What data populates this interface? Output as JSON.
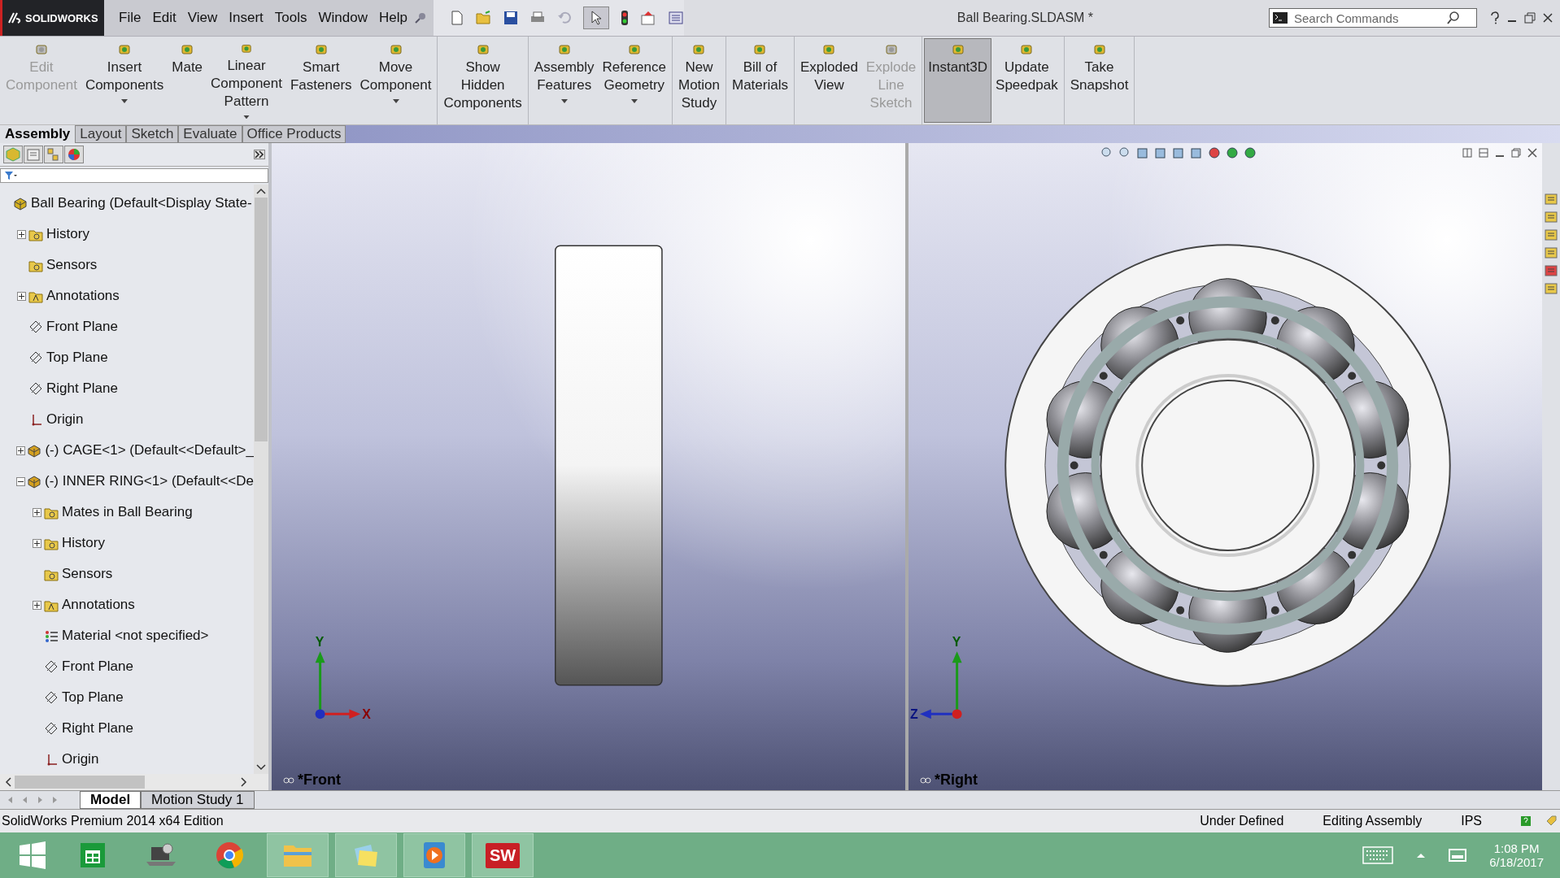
{
  "app": {
    "logo": "SOLIDWORKS",
    "menu": [
      "File",
      "Edit",
      "View",
      "Insert",
      "Tools",
      "Window",
      "Help"
    ],
    "title": "Ball Bearing.SLDASM *",
    "search": {
      "placeholder": "Search Commands"
    }
  },
  "ribbon": {
    "groups": [
      {
        "buttons": [
          {
            "label": "Edit\nComponent",
            "disabled": true,
            "selected": false,
            "dropdown": false
          },
          {
            "label": "Insert\nComponents",
            "disabled": false,
            "selected": false,
            "dropdown": true
          },
          {
            "label": "Mate",
            "disabled": false,
            "selected": false,
            "dropdown": false
          },
          {
            "label": "Linear\nComponent\nPattern",
            "disabled": false,
            "selected": false,
            "dropdown": true
          },
          {
            "label": "Smart\nFasteners",
            "disabled": false,
            "selected": false,
            "dropdown": false
          },
          {
            "label": "Move\nComponent",
            "disabled": false,
            "selected": false,
            "dropdown": true
          }
        ]
      },
      {
        "buttons": [
          {
            "label": "Show\nHidden\nComponents",
            "disabled": false,
            "selected": false,
            "dropdown": false
          }
        ]
      },
      {
        "buttons": [
          {
            "label": "Assembly\nFeatures",
            "disabled": false,
            "selected": false,
            "dropdown": true
          },
          {
            "label": "Reference\nGeometry",
            "disabled": false,
            "selected": false,
            "dropdown": true
          }
        ]
      },
      {
        "buttons": [
          {
            "label": "New\nMotion\nStudy",
            "disabled": false,
            "selected": false,
            "dropdown": false
          }
        ]
      },
      {
        "buttons": [
          {
            "label": "Bill of\nMaterials",
            "disabled": false,
            "selected": false,
            "dropdown": false
          }
        ]
      },
      {
        "buttons": [
          {
            "label": "Exploded\nView",
            "disabled": false,
            "selected": false,
            "dropdown": false
          },
          {
            "label": "Explode\nLine\nSketch",
            "disabled": true,
            "selected": false,
            "dropdown": false
          }
        ]
      },
      {
        "buttons": [
          {
            "label": "Instant3D",
            "disabled": false,
            "selected": true,
            "dropdown": false
          },
          {
            "label": "Update\nSpeedpak",
            "disabled": false,
            "selected": false,
            "dropdown": false
          }
        ]
      },
      {
        "buttons": [
          {
            "label": "Take\nSnapshot",
            "disabled": false,
            "selected": false,
            "dropdown": false
          }
        ]
      }
    ],
    "tabs": [
      {
        "label": "Assembly",
        "selected": true
      },
      {
        "label": "Layout",
        "selected": false
      },
      {
        "label": "Sketch",
        "selected": false
      },
      {
        "label": "Evaluate",
        "selected": false
      },
      {
        "label": "Office Products",
        "selected": false
      }
    ]
  },
  "tree": {
    "root": {
      "label": "Ball Bearing  (Default<Display State-",
      "kind": "assembly",
      "children": [
        {
          "label": "History",
          "kind": "history",
          "expanded": false
        },
        {
          "label": "Sensors",
          "kind": "sensor"
        },
        {
          "label": "Annotations",
          "kind": "annotation",
          "expanded": false
        },
        {
          "label": "Front Plane",
          "kind": "plane"
        },
        {
          "label": "Top Plane",
          "kind": "plane"
        },
        {
          "label": "Right Plane",
          "kind": "plane"
        },
        {
          "label": "Origin",
          "kind": "origin"
        },
        {
          "label": "(-) CAGE<1> (Default<<Default>_",
          "kind": "part",
          "expanded": false
        },
        {
          "label": "(-) INNER RING<1> (Default<<De",
          "kind": "part",
          "expanded": true,
          "children": [
            {
              "label": "Mates in Ball Bearing",
              "kind": "mates",
              "expanded": false
            },
            {
              "label": "History",
              "kind": "history",
              "expanded": false
            },
            {
              "label": "Sensors",
              "kind": "sensor"
            },
            {
              "label": "Annotations",
              "kind": "annotation",
              "expanded": false
            },
            {
              "label": "Material <not specified>",
              "kind": "material"
            },
            {
              "label": "Front Plane",
              "kind": "plane"
            },
            {
              "label": "Top Plane",
              "kind": "plane"
            },
            {
              "label": "Right Plane",
              "kind": "plane"
            },
            {
              "label": "Origin",
              "kind": "origin"
            }
          ]
        }
      ]
    }
  },
  "viewports": [
    {
      "kind": "front",
      "label": "*Front",
      "axes": [
        "Y",
        "X"
      ]
    },
    {
      "kind": "right",
      "label": "*Right",
      "axes": [
        "Y",
        "Z"
      ]
    }
  ],
  "bottom_tabs": [
    {
      "label": "Model",
      "selected": true
    },
    {
      "label": "Motion Study 1",
      "selected": false
    }
  ],
  "status_bar": {
    "edition": "SolidWorks Premium 2014 x64 Edition",
    "items": [
      "Under Defined",
      "Editing Assembly",
      "IPS"
    ]
  },
  "taskbar": {
    "apps": [
      {
        "kind": "store",
        "running": false
      },
      {
        "kind": "laptop",
        "running": false
      },
      {
        "kind": "chrome",
        "running": false
      },
      {
        "kind": "folder",
        "running": true
      },
      {
        "kind": "notes",
        "running": true
      },
      {
        "kind": "media",
        "running": true
      },
      {
        "kind": "sw",
        "running": true,
        "text": "SW"
      }
    ],
    "time": "1:08 PM",
    "date": "6/18/2017"
  }
}
